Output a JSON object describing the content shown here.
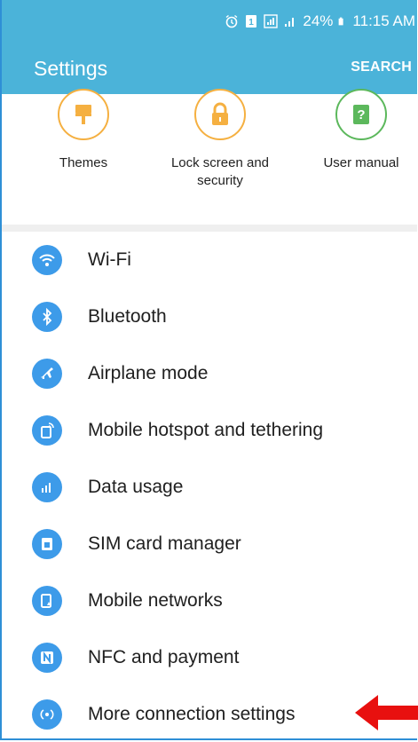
{
  "status_bar": {
    "battery": "24%",
    "time": "11:15 AM"
  },
  "app_bar": {
    "title": "Settings",
    "search_label": "SEARCH"
  },
  "quick_settings": [
    {
      "label": "Themes",
      "icon": "themes-icon",
      "color": "#f5b041"
    },
    {
      "label": "Lock screen and\nsecurity",
      "icon": "lock-icon",
      "color": "#f5b041"
    },
    {
      "label": "User manual",
      "icon": "help-book-icon",
      "color": "#5cb85c"
    }
  ],
  "settings_list": [
    {
      "label": "Wi-Fi",
      "icon": "wifi-icon"
    },
    {
      "label": "Bluetooth",
      "icon": "bluetooth-icon"
    },
    {
      "label": "Airplane mode",
      "icon": "airplane-icon"
    },
    {
      "label": "Mobile hotspot and tethering",
      "icon": "hotspot-icon"
    },
    {
      "label": "Data usage",
      "icon": "data-usage-icon"
    },
    {
      "label": "SIM card manager",
      "icon": "sim-card-icon"
    },
    {
      "label": "Mobile networks",
      "icon": "mobile-network-icon"
    },
    {
      "label": "NFC and payment",
      "icon": "nfc-icon"
    },
    {
      "label": "More connection settings",
      "icon": "more-connection-icon"
    }
  ],
  "colors": {
    "header": "#4bb3d9",
    "icon_blue": "#3d9be9",
    "annotation_arrow": "#e8100f"
  }
}
